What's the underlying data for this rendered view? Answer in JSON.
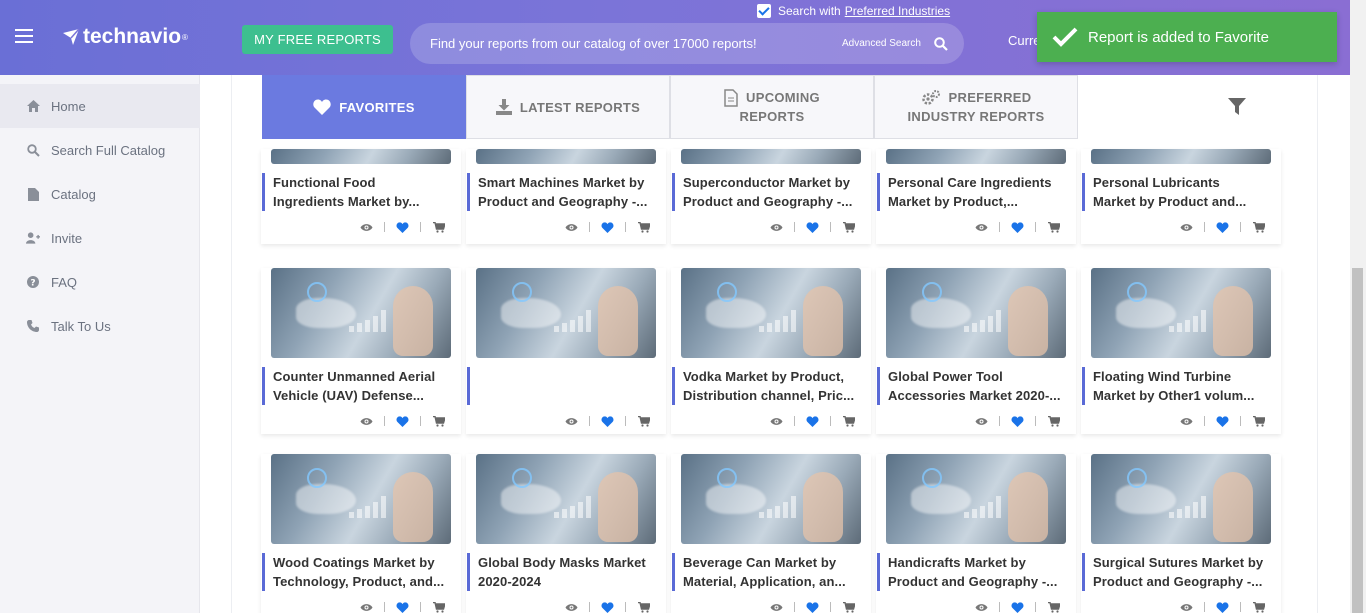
{
  "header": {
    "logo_text": "technavio",
    "logo_mark": "®",
    "free_reports_label": "MY FREE REPORTS",
    "pref_prefix": "Search with",
    "pref_link": "Preferred Industries",
    "search_placeholder": "Find your reports from our catalog of over 17000 reports!",
    "advanced_search": "Advanced Search",
    "currency_partial": "Curre"
  },
  "toast": {
    "message": "Report is added to Favorite"
  },
  "sidebar": {
    "items": [
      {
        "label": "Home",
        "icon": "home-icon"
      },
      {
        "label": "Search Full Catalog",
        "icon": "search-icon"
      },
      {
        "label": "Catalog",
        "icon": "document-icon"
      },
      {
        "label": "Invite",
        "icon": "add-user-icon"
      },
      {
        "label": "FAQ",
        "icon": "question-icon"
      },
      {
        "label": "Talk To Us",
        "icon": "phone-icon"
      }
    ]
  },
  "tabs": [
    {
      "line1": "FAVORITES",
      "line2": "",
      "icon": "heart-icon"
    },
    {
      "line1": "LATEST REPORTS",
      "line2": "",
      "icon": "download-icon"
    },
    {
      "line1": "UPCOMING",
      "line2": "REPORTS",
      "icon": "document-icon"
    },
    {
      "line1": "PREFERRED",
      "line2": "INDUSTRY REPORTS",
      "icon": "gears-icon"
    }
  ],
  "cards": [
    {
      "line1": "Functional Food",
      "line2": "Ingredients Market by..."
    },
    {
      "line1": "Smart Machines Market by",
      "line2": "Product and Geography -..."
    },
    {
      "line1": "Superconductor Market by",
      "line2": "Product and Geography -..."
    },
    {
      "line1": "Personal Care Ingredients",
      "line2": "Market by Product,..."
    },
    {
      "line1": "Personal Lubricants",
      "line2": "Market by Product and..."
    },
    {
      "line1": "Counter Unmanned Aerial",
      "line2": "Vehicle (UAV) Defense..."
    },
    {
      "line1": "",
      "line2": ""
    },
    {
      "line1": "Vodka Market by Product,",
      "line2": "Distribution channel, Pric..."
    },
    {
      "line1": "Global Power Tool",
      "line2": "Accessories Market 2020-..."
    },
    {
      "line1": "Floating Wind Turbine",
      "line2": "Market by Other1 volum..."
    },
    {
      "line1": "Wood Coatings Market by",
      "line2": "Technology, Product, and..."
    },
    {
      "line1": "Global Body Masks Market",
      "line2": "2020-2024"
    },
    {
      "line1": "Beverage Can Market by",
      "line2": "Material, Application, an..."
    },
    {
      "line1": "Handicrafts Market by",
      "line2": "Product and Geography -..."
    },
    {
      "line1": "Surgical Sutures Market by",
      "line2": "Product and Geography -..."
    }
  ],
  "colors": {
    "header_start": "#6a6fd6",
    "header_end": "#8a6ed3",
    "accent": "#6b7ae0",
    "free_button": "#3dbf8f",
    "toast": "#4caf50",
    "favorite_heart": "#1a73e8"
  }
}
